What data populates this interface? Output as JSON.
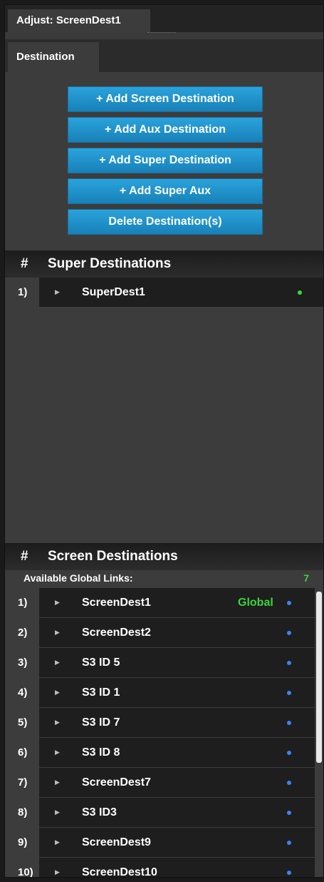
{
  "window": {
    "title": "Adjust: ScreenDest1"
  },
  "tabs": [
    {
      "label": "Destination",
      "active": true
    }
  ],
  "actions": {
    "add_screen": "+ Add Screen Destination",
    "add_aux": "+ Add Aux Destination",
    "add_super": "+ Add Super Destination",
    "add_super_aux": "+ Add Super Aux",
    "delete": "Delete Destination(s)"
  },
  "super_destinations": {
    "hash": "#",
    "title": "Super Destinations",
    "items": [
      {
        "num": "1)",
        "name": "SuperDest1",
        "status_color": "#33dd33"
      }
    ]
  },
  "screen_destinations": {
    "hash": "#",
    "title": "Screen Destinations",
    "available_links_label": "Available Global Links:",
    "available_links_count": "7",
    "items": [
      {
        "num": "1)",
        "name": "ScreenDest1",
        "badge": "Global"
      },
      {
        "num": "2)",
        "name": "ScreenDest2"
      },
      {
        "num": "3)",
        "name": "S3 ID 5"
      },
      {
        "num": "4)",
        "name": "S3 ID 1"
      },
      {
        "num": "5)",
        "name": "S3 ID 7"
      },
      {
        "num": "6)",
        "name": "S3 ID 8"
      },
      {
        "num": "7)",
        "name": "ScreenDest7"
      },
      {
        "num": "8)",
        "name": "S3 ID3"
      },
      {
        "num": "9)",
        "name": "ScreenDest9"
      },
      {
        "num": "10)",
        "name": "ScreenDest10"
      }
    ],
    "status_color": "#3b82f6"
  },
  "colors": {
    "accent_button": "#1e90c8",
    "global_text": "#3cd43c"
  }
}
